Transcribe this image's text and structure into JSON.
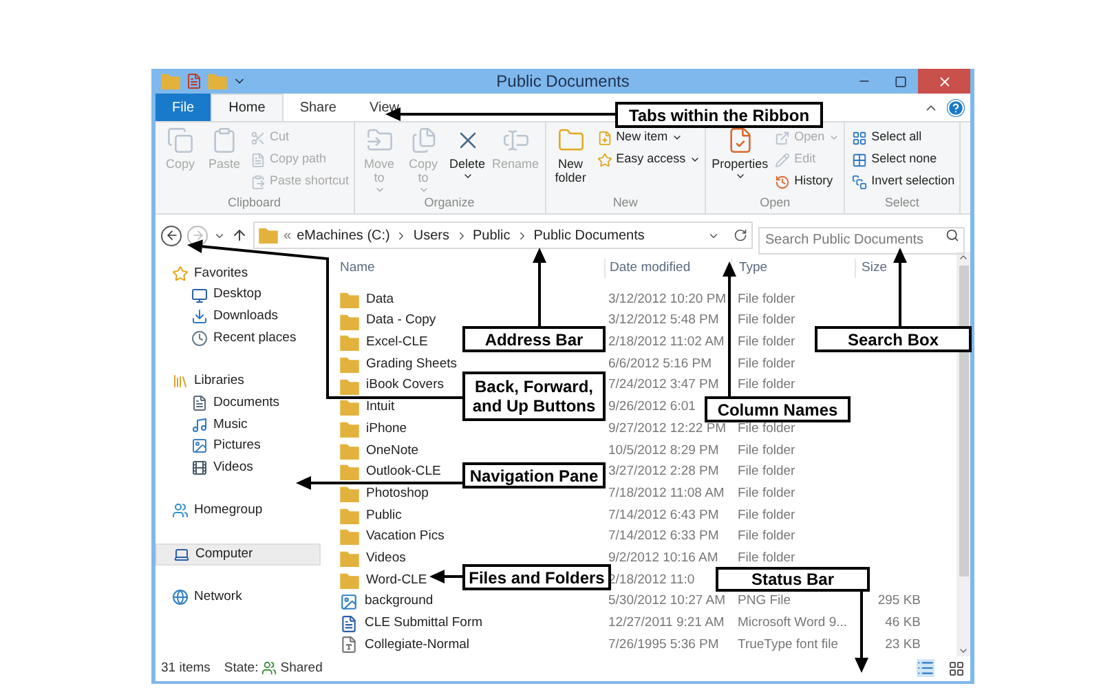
{
  "window": {
    "title": "Public Documents"
  },
  "ribbon": {
    "tabs": [
      {
        "label": "File",
        "kind": "file",
        "selected": false
      },
      {
        "label": "Home",
        "kind": "tab",
        "selected": true
      },
      {
        "label": "Share",
        "kind": "tab",
        "selected": false
      },
      {
        "label": "View",
        "kind": "tab",
        "selected": false
      }
    ],
    "groups": [
      {
        "label": "Clipboard",
        "items": [
          {
            "label": "Copy",
            "kind": "large",
            "disabled": true,
            "dropdown": false
          },
          {
            "label": "Paste",
            "kind": "large",
            "disabled": true,
            "dropdown": false
          },
          {
            "label": "Cut",
            "kind": "small",
            "disabled": true,
            "dropdown": false
          },
          {
            "label": "Copy path",
            "kind": "small",
            "disabled": true,
            "dropdown": false
          },
          {
            "label": "Paste shortcut",
            "kind": "small",
            "disabled": true,
            "dropdown": false
          }
        ]
      },
      {
        "label": "Organize",
        "items": [
          {
            "label": "Move to",
            "kind": "large",
            "disabled": true,
            "dropdown": true
          },
          {
            "label": "Copy to",
            "kind": "large",
            "disabled": true,
            "dropdown": true
          },
          {
            "label": "Delete",
            "kind": "large",
            "disabled": false,
            "dropdown": true
          },
          {
            "label": "Rename",
            "kind": "large",
            "disabled": true,
            "dropdown": false
          }
        ]
      },
      {
        "label": "New",
        "items": [
          {
            "label": "New folder",
            "kind": "large",
            "disabled": false,
            "dropdown": false
          },
          {
            "label": "New item",
            "kind": "small",
            "disabled": false,
            "dropdown": true
          },
          {
            "label": "Easy access",
            "kind": "small",
            "disabled": false,
            "dropdown": true
          }
        ]
      },
      {
        "label": "Open",
        "items": [
          {
            "label": "Properties",
            "kind": "large",
            "disabled": false,
            "dropdown": true
          },
          {
            "label": "Open",
            "kind": "small",
            "disabled": true,
            "dropdown": true
          },
          {
            "label": "Edit",
            "kind": "small",
            "disabled": true,
            "dropdown": false
          },
          {
            "label": "History",
            "kind": "small",
            "disabled": false,
            "dropdown": false
          }
        ]
      },
      {
        "label": "Select",
        "items": [
          {
            "label": "Select all",
            "kind": "small",
            "disabled": false,
            "dropdown": false
          },
          {
            "label": "Select none",
            "kind": "small",
            "disabled": false,
            "dropdown": false
          },
          {
            "label": "Invert selection",
            "kind": "small",
            "disabled": false,
            "dropdown": false
          }
        ]
      }
    ]
  },
  "address": {
    "prefix": "«",
    "path": [
      "eMachines (C:)",
      "Users",
      "Public",
      "Public Documents"
    ]
  },
  "search": {
    "placeholder": "Search Public Documents"
  },
  "navigation": [
    {
      "label": "Favorites",
      "kind": "favorites",
      "selected": false,
      "children": [
        {
          "label": "Desktop",
          "kind": "desktop",
          "selected": false
        },
        {
          "label": "Downloads",
          "kind": "downloads",
          "selected": false
        },
        {
          "label": "Recent places",
          "kind": "recent",
          "selected": false
        }
      ]
    },
    {
      "label": "Libraries",
      "kind": "libraries",
      "selected": false,
      "children": [
        {
          "label": "Documents",
          "kind": "documents",
          "selected": false
        },
        {
          "label": "Music",
          "kind": "music",
          "selected": false
        },
        {
          "label": "Pictures",
          "kind": "pictures",
          "selected": false
        },
        {
          "label": "Videos",
          "kind": "videos",
          "selected": false
        }
      ]
    },
    {
      "label": "Homegroup",
      "kind": "homegroup",
      "selected": false
    },
    {
      "label": "Computer",
      "kind": "computer",
      "selected": true
    },
    {
      "label": "Network",
      "kind": "network",
      "selected": false
    }
  ],
  "columns": [
    "Name",
    "Date modified",
    "Type",
    "Size"
  ],
  "rows": [
    {
      "name": "Data",
      "kind": "folder",
      "date": "3/12/2012 10:20 PM",
      "type": "File folder"
    },
    {
      "name": "Data - Copy",
      "kind": "folder",
      "date": "3/12/2012 5:48 PM",
      "type": "File folder"
    },
    {
      "name": "Excel-CLE",
      "kind": "folder",
      "date": "2/18/2012 11:02 AM",
      "type": "File folder"
    },
    {
      "name": "Grading Sheets",
      "kind": "folder",
      "date": "6/6/2012 5:16 PM",
      "type": "File folder"
    },
    {
      "name": "iBook Covers",
      "kind": "folder",
      "date": "7/24/2012 3:47 PM",
      "type": "File folder"
    },
    {
      "name": "Intuit",
      "kind": "folder",
      "date": "9/26/2012 6:01"
    },
    {
      "name": "iPhone",
      "kind": "folder",
      "date": "9/27/2012 12:22 PM",
      "type": "File folder"
    },
    {
      "name": "OneNote",
      "kind": "folder",
      "date": "10/5/2012 8:29 PM",
      "type": "File folder"
    },
    {
      "name": "Outlook-CLE",
      "kind": "folder",
      "date": "3/27/2012 2:28 PM",
      "type": "File folder"
    },
    {
      "name": "Photoshop",
      "kind": "folder",
      "date": "7/18/2012 11:08 AM",
      "type": "File folder"
    },
    {
      "name": "Public",
      "kind": "folder",
      "date": "7/14/2012 6:43 PM",
      "type": "File folder"
    },
    {
      "name": "Vacation Pics",
      "kind": "folder",
      "date": "7/14/2012 6:33 PM",
      "type": "File folder"
    },
    {
      "name": "Videos",
      "kind": "folder",
      "date": "9/2/2012 10:16 AM",
      "type": "File folder"
    },
    {
      "name": "Word-CLE",
      "kind": "folder",
      "date": "2/18/2012 11:0"
    },
    {
      "name": "background",
      "kind": "image",
      "date": "5/30/2012 10:27 AM",
      "type": "PNG File",
      "size": "295 KB"
    },
    {
      "name": "CLE Submittal Form",
      "kind": "word",
      "date": "12/27/2011 9:21 AM",
      "type": "Microsoft Word 9...",
      "size": "46 KB"
    },
    {
      "name": "Collegiate-Normal",
      "kind": "font",
      "date": "7/26/1995 5:36 PM",
      "type": "TrueType font file",
      "size": "23 KB"
    }
  ],
  "status_bar": {
    "count": "31 items",
    "state_label": "State:",
    "state": "Shared"
  },
  "callouts": [
    {
      "label": "Tabs within the Ribbon"
    },
    {
      "label": "Address Bar"
    },
    {
      "label": "Search Box"
    },
    {
      "label": "Back, Forward, and Up Buttons"
    },
    {
      "label": "Column Names"
    },
    {
      "label": "Navigation Pane"
    },
    {
      "label": "Files and Folders"
    },
    {
      "label": "Status Bar"
    }
  ]
}
